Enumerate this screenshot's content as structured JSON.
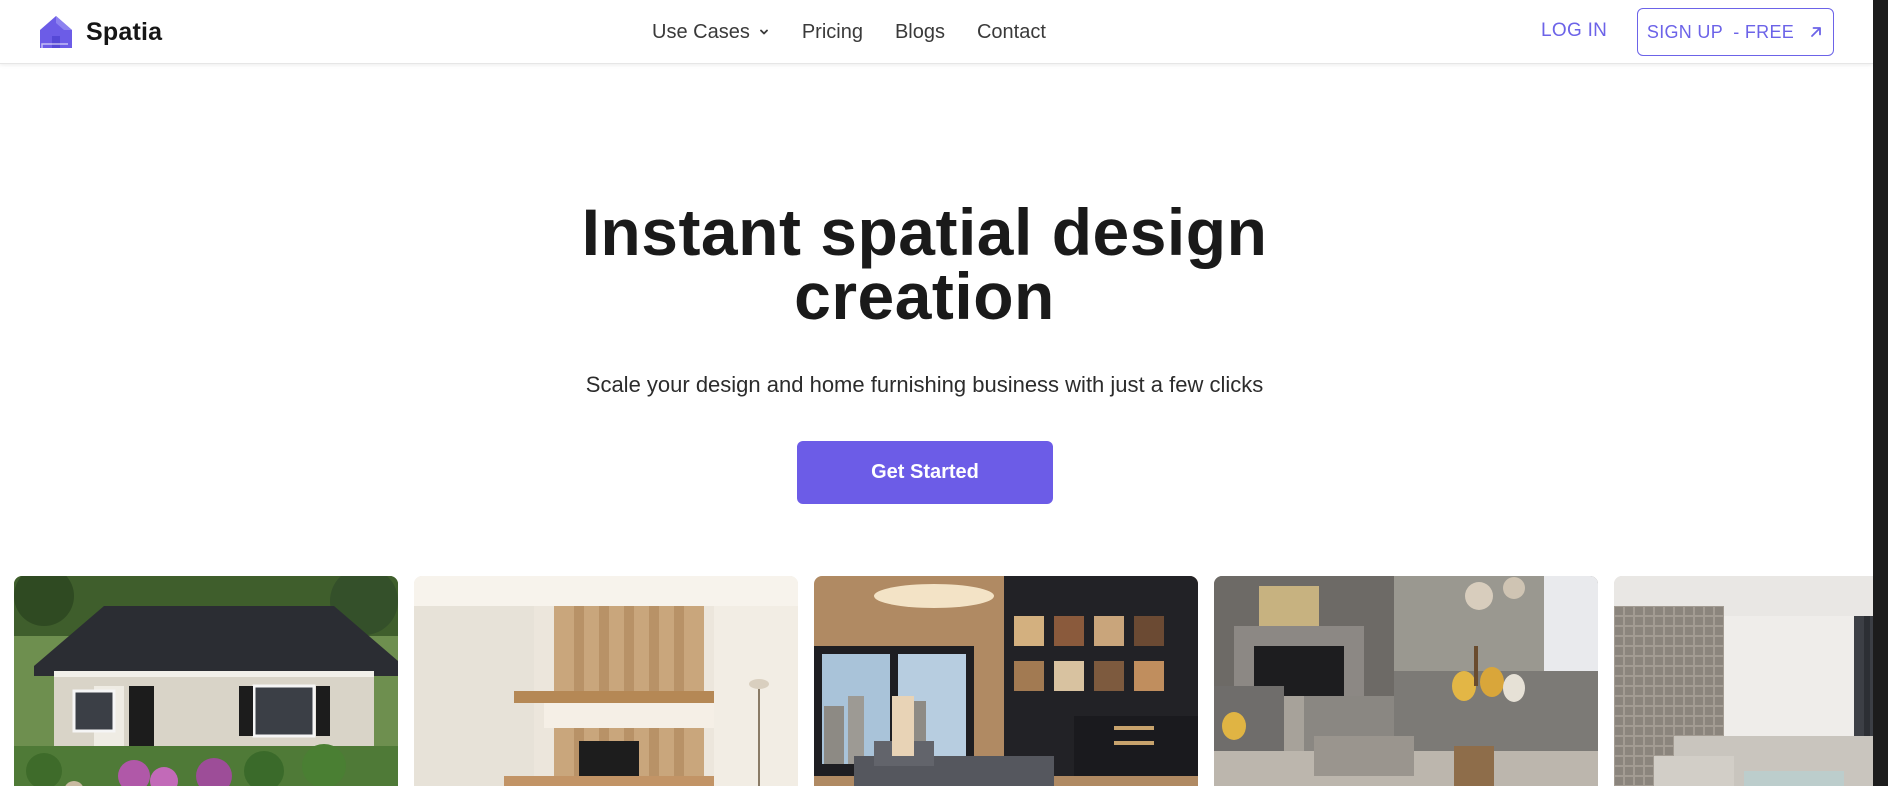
{
  "header": {
    "brand_name": "Spatia",
    "nav": [
      {
        "label": "Use Cases",
        "has_dropdown": true
      },
      {
        "label": "Pricing"
      },
      {
        "label": "Blogs"
      },
      {
        "label": "Contact"
      }
    ],
    "login_label": "LOG IN",
    "signup_label": "SIGN UP  - FREE"
  },
  "hero": {
    "title_line1": "Instant spatial design",
    "title_line2": "creation",
    "subtitle": "Scale your design and home furnishing business with just a few clicks",
    "cta_label": "Get Started"
  },
  "gallery": {
    "items": [
      {
        "subject": "house-exterior-landscaping"
      },
      {
        "subject": "wood-tv-wall-interior"
      },
      {
        "subject": "living-room-bookshelf-city-view"
      },
      {
        "subject": "living-room-fireplace-sectional"
      },
      {
        "subject": "modern-lounge-sectional"
      }
    ]
  },
  "colors": {
    "accent": "#6c5ce7",
    "accent_text": "#6c63e8",
    "heading": "#1a1a1a"
  },
  "icons": [
    "house-logo-icon",
    "chevron-down-icon",
    "arrow-up-right-icon"
  ]
}
